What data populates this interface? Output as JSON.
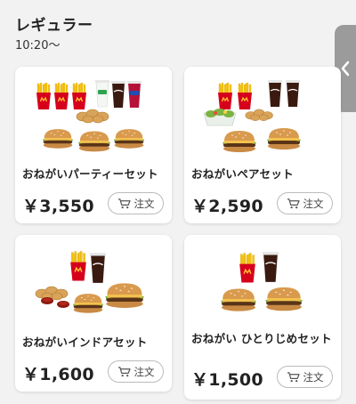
{
  "section": {
    "title": "レギュラー",
    "time": "10:20〜"
  },
  "cards": [
    {
      "name": "おねがいパーティーセット",
      "price": "￥3,550",
      "order_label": "注文"
    },
    {
      "name": "おねがいペアセット",
      "price": "￥2,590",
      "order_label": "注文"
    },
    {
      "name": "おねがいインドアセット",
      "price": "￥1,600",
      "order_label": "注文"
    },
    {
      "name": "おねがい ひとりじめセット",
      "price": "￥1,500",
      "order_label": "注文"
    }
  ],
  "icons": {
    "side_tab": "chevron-left-icon",
    "cart": "cart-icon"
  },
  "colors": {
    "background": "#f2f2f2",
    "card": "#ffffff",
    "side_tab": "#9b9b9b",
    "fries_box": "#d6001c",
    "fries": "#f5c518",
    "bun": "#d99a4e"
  }
}
